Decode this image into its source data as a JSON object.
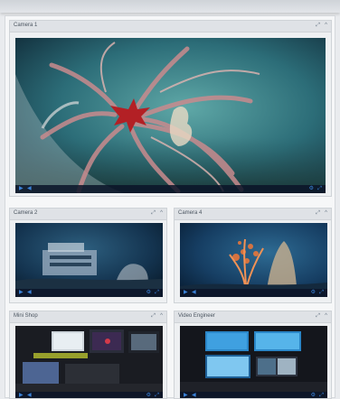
{
  "panels": [
    {
      "title": "Camera 1",
      "controls": [
        "⤢",
        "^"
      ]
    },
    {
      "title": "Camera 2",
      "controls": [
        "⤢",
        "^"
      ]
    },
    {
      "title": "Camera 4",
      "controls": [
        "⤢",
        "^"
      ]
    },
    {
      "title": "Mini Shop",
      "controls": [
        "⤢",
        "^"
      ]
    },
    {
      "title": "Video Engineer",
      "controls": [
        "⤢",
        "^"
      ]
    }
  ],
  "player_controls": {
    "play": "▶",
    "volume": "◀",
    "settings": "⚙",
    "fullscreen": "⤢"
  },
  "icons": {
    "play": "play-icon",
    "volume": "volume-icon",
    "settings": "settings-icon",
    "fullscreen": "fullscreen-icon",
    "expand": "expand-icon",
    "collapse": "collapse-icon"
  },
  "colors": {
    "accent": "#3a82d8",
    "titlebar": "#dfe2e6"
  }
}
